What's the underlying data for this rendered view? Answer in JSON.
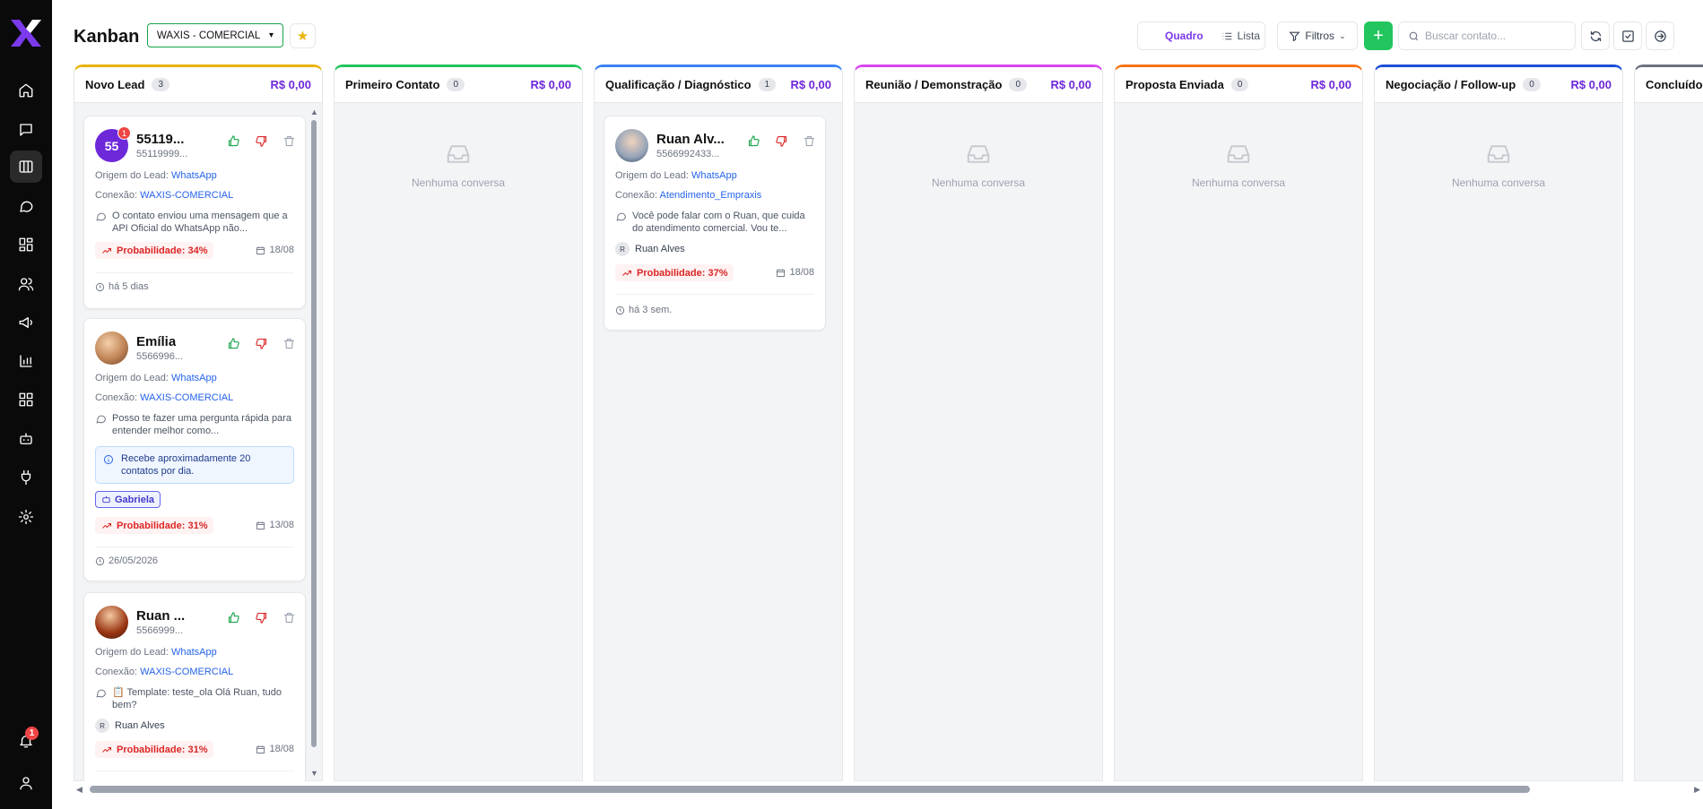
{
  "sidebar": {
    "items": [
      {
        "name": "home-icon"
      },
      {
        "name": "chat-icon"
      },
      {
        "name": "kanban-icon",
        "active": true
      },
      {
        "name": "message-circle-icon"
      },
      {
        "name": "dashboard-icon"
      },
      {
        "name": "users-icon"
      },
      {
        "name": "megaphone-icon"
      },
      {
        "name": "bar-chart-icon"
      },
      {
        "name": "apps-icon"
      },
      {
        "name": "bot-icon"
      },
      {
        "name": "plug-icon"
      },
      {
        "name": "settings-icon"
      }
    ],
    "notifications_count": "1"
  },
  "header": {
    "title": "Kanban",
    "connection_select": "WAXIS - COMERCIAL",
    "view_board": "Quadro",
    "view_list": "Lista",
    "filters": "Filtros",
    "search_placeholder": "Buscar contato..."
  },
  "colors": {
    "accent": "#6d28d9",
    "primary_green": "#22c55e",
    "brand": "#7c3aed"
  },
  "columns": [
    {
      "name": "Novo Lead",
      "count": "3",
      "value": "R$ 0,00",
      "color": "#eab308"
    },
    {
      "name": "Primeiro Contato",
      "count": "0",
      "value": "R$ 0,00",
      "color": "#22c55e",
      "empty_text": "Nenhuma conversa"
    },
    {
      "name": "Qualificação / Diagnóstico",
      "count": "1",
      "value": "R$ 0,00",
      "color": "#3b82f6"
    },
    {
      "name": "Reunião / Demonstração",
      "count": "0",
      "value": "R$ 0,00",
      "color": "#d946ef",
      "empty_text": "Nenhuma conversa"
    },
    {
      "name": "Proposta Enviada",
      "count": "0",
      "value": "R$ 0,00",
      "color": "#f97316",
      "empty_text": "Nenhuma conversa"
    },
    {
      "name": "Negociação / Follow-up",
      "count": "0",
      "value": "R$ 0,00",
      "color": "#1d4ed8",
      "empty_text": "Nenhuma conversa"
    },
    {
      "name": "Concluído",
      "color": "#6b7280"
    }
  ],
  "cards": [
    {
      "name": "55119...",
      "phone": "55119999...",
      "avatar_text": "55",
      "avatar_color": "#6d28d9",
      "badge": "1",
      "origin_label": "Origem do Lead:",
      "origin": "WhatsApp",
      "connection_label": "Conexão:",
      "connection": "WAXIS-COMERCIAL",
      "message": "O contato enviou uma mensagem que a API Oficial do WhatsApp não...",
      "probability": "Probabilidade: 34%",
      "date": "18/08",
      "footer": "há 5 dias"
    },
    {
      "name": "Emília",
      "phone": "5566996...",
      "avatar_color": "#c08457",
      "origin_label": "Origem do Lead:",
      "origin": "WhatsApp",
      "connection_label": "Conexão:",
      "connection": "WAXIS-COMERCIAL",
      "message": "Posso te fazer uma pergunta rápida para entender melhor como...",
      "note": "Recebe aproximadamente 20 contatos por dia.",
      "tag": "Gabriela",
      "probability": "Probabilidade: 31%",
      "date": "13/08",
      "footer": "26/05/2026"
    },
    {
      "name": "Ruan ...",
      "phone": "5566999...",
      "avatar_color": "#9a3412",
      "origin_label": "Origem do Lead:",
      "origin": "WhatsApp",
      "connection_label": "Conexão:",
      "connection": "WAXIS-COMERCIAL",
      "message": "📋 Template: teste_ola Olá Ruan, tudo bem?",
      "assignee": "Ruan Alves",
      "assignee_initial": "R",
      "probability": "Probabilidade: 31%",
      "date": "18/08"
    },
    {
      "name": "Ruan Alv...",
      "phone": "5566992433...",
      "avatar_color": "#64748b",
      "origin_label": "Origem do Lead:",
      "origin": "WhatsApp",
      "connection_label": "Conexão:",
      "connection": "Atendimento_Empraxis",
      "message": "Você pode falar com o Ruan, que cuida do atendimento comercial. Vou te...",
      "assignee": "Ruan Alves",
      "assignee_initial": "R",
      "probability": "Probabilidade: 37%",
      "date": "18/08",
      "footer": "há 3 sem."
    }
  ]
}
